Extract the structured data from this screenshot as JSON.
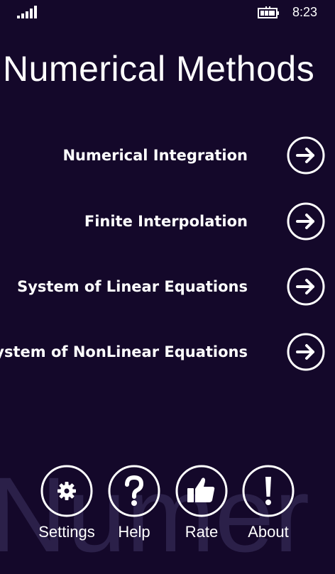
{
  "status_bar": {
    "time": "8:23",
    "signal_icon": "signal-bars-icon",
    "battery_icon": "battery-charging-icon"
  },
  "title": "Numerical Methods",
  "watermark": "Numer",
  "menu": [
    {
      "label": "Numerical Integration",
      "icon": "arrow-right-circle-icon"
    },
    {
      "label": "Finite Interpolation",
      "icon": "arrow-right-circle-icon"
    },
    {
      "label": "System of Linear Equations",
      "icon": "arrow-right-circle-icon"
    },
    {
      "label": "System of NonLinear Equations",
      "icon": "arrow-right-circle-icon"
    }
  ],
  "app_bar": {
    "settings": {
      "label": "Settings",
      "icon": "gear-icon"
    },
    "help": {
      "label": "Help",
      "icon": "question-mark-icon"
    },
    "rate": {
      "label": "Rate",
      "icon": "thumbs-up-icon"
    },
    "about": {
      "label": "About",
      "icon": "exclamation-icon"
    }
  },
  "colors": {
    "background": "#14082a",
    "foreground": "#ffffff",
    "watermark": "#2b2049"
  }
}
